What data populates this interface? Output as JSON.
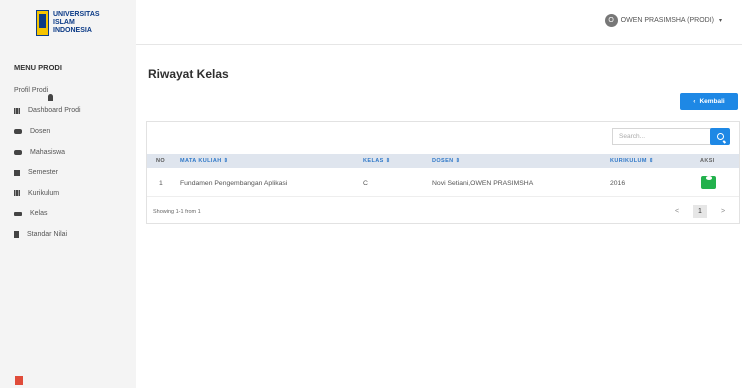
{
  "brand": {
    "line1": "UNIVERSITAS",
    "line2": "ISLAM",
    "line3": "INDONESIA"
  },
  "sidebar": {
    "title": "MENU PRODI",
    "items": [
      {
        "label": "Profil Prodi",
        "icon": "user-icon"
      },
      {
        "label": "Dashboard Prodi",
        "icon": "grid-icon"
      },
      {
        "label": "Dosen",
        "icon": "users-icon"
      },
      {
        "label": "Mahasiswa",
        "icon": "users-icon"
      },
      {
        "label": "Semester",
        "icon": "book-icon"
      },
      {
        "label": "Kurikulum",
        "icon": "table-icon"
      },
      {
        "label": "Kelas",
        "icon": "graduation-cap-icon"
      },
      {
        "label": "Standar Nilai",
        "icon": "book-icon"
      }
    ]
  },
  "topbar": {
    "avatar_initial": "O",
    "user_name": "OWEN PRASIMSHA (PRODI)",
    "caret": "▾"
  },
  "main": {
    "title": "Riwayat Kelas",
    "back_arrow": "‹",
    "back_label": "Kembali",
    "search_placeholder": "Search..."
  },
  "table": {
    "headers": [
      "NO",
      "MATA KULIAH ⇕",
      "KELAS ⇕",
      "DOSEN ⇕",
      "KURIKULUM ⇕",
      "AKSI"
    ],
    "rows": [
      {
        "no": "1",
        "mata_kuliah": "Fundamen Pengembangan Aplikasi",
        "kelas": "C",
        "dosen": "Novi Setiani,OWEN PRASIMSHA",
        "kurikulum": "2016"
      }
    ],
    "info": "Showing 1-1 from 1",
    "pagination": {
      "prev": "<",
      "current": "1",
      "next": ">"
    }
  },
  "colors": {
    "accent": "#1e88e5",
    "action": "#22b14c",
    "header_bg": "#dfe5ee"
  }
}
